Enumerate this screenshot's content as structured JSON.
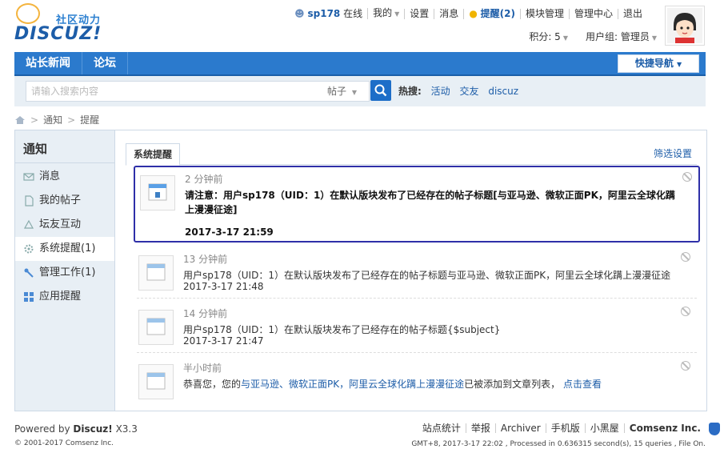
{
  "logo": {
    "brand": "DISCUZ!",
    "tagline": "社区动力"
  },
  "topnav": {
    "username": "sp178",
    "online": "在线",
    "my": "我的",
    "settings": "设置",
    "messages": "消息",
    "remind": "提醒(2)",
    "block_mgmt": "模块管理",
    "admin_center": "管理中心",
    "logout": "退出"
  },
  "subnav": {
    "credits": "积分: 5",
    "usergroup": "用户组: 管理员"
  },
  "bluenav": {
    "items": [
      "站长新闻",
      "论坛"
    ],
    "quick": "快捷导航"
  },
  "search": {
    "placeholder": "请输入搜索内容",
    "type": "帖子",
    "hot_label": "热搜:",
    "hot": [
      "活动",
      "交友",
      "discuz"
    ]
  },
  "breadcrumb": [
    "通知",
    "提醒"
  ],
  "sidebar": {
    "title": "通知",
    "items": [
      {
        "label": "消息",
        "icon": "envelope-icon"
      },
      {
        "label": "我的帖子",
        "icon": "document-icon"
      },
      {
        "label": "坛友互动",
        "icon": "recycle-icon"
      },
      {
        "label": "系统提醒(1)",
        "icon": "gear-icon"
      },
      {
        "label": "管理工作(1)",
        "icon": "wrench-icon"
      },
      {
        "label": "应用提醒",
        "icon": "grid-icon"
      }
    ]
  },
  "tab": "系统提醒",
  "filter": "筛选设置",
  "notices": [
    {
      "time": "2 分钟前",
      "msg": "请注意：用户sp178（UID：1）在默认版块发布了已经存在的帖子标题[与亚马逊、微软正面PK，阿里云全球化蹒上漫漫征途]",
      "date": "2017-3-17 21:59"
    },
    {
      "time": "13 分钟前",
      "msg": "用户sp178（UID：1）在默认版块发布了已经存在的帖子标题与亚马逊、微软正面PK，阿里云全球化蹒上漫漫征途",
      "date": "2017-3-17 21:48"
    },
    {
      "time": "14 分钟前",
      "msg": "用户sp178（UID：1）在默认版块发布了已经存在的帖子标题{$subject}",
      "date": "2017-3-17 21:47"
    },
    {
      "time": "半小时前",
      "msg_pre": "恭喜您，您的",
      "msg_link": "与亚马逊、微软正面PK，阿里云全球化蹒上漫漫征途",
      "msg_mid": "已被添加到文章列表，",
      "msg_link2": "点击查看"
    }
  ],
  "footer": {
    "powered": "Powered by",
    "product": "Discuz!",
    "version": "X3.3",
    "copyright": "© 2001-2017 Comsenz Inc.",
    "links": [
      "站点统计",
      "举报",
      "Archiver",
      "手机版",
      "小黑屋",
      "Comsenz Inc."
    ],
    "stats": "GMT+8, 2017-3-17 22:02 , Processed in 0.636315 second(s), 15 queries , File On."
  },
  "colors": {
    "brand_blue": "#2b7acd",
    "link": "#1d5da8",
    "highlight_border": "#2e2fa8"
  }
}
